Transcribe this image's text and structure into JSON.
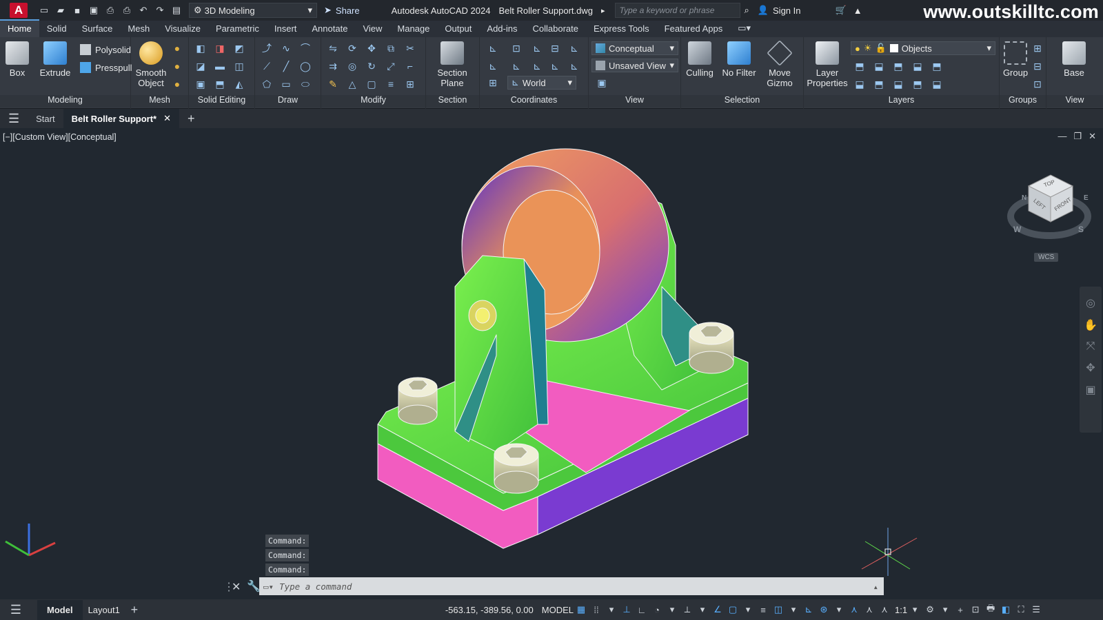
{
  "titlebar": {
    "logo": "A",
    "workspace": "3D Modeling",
    "share": "Share",
    "app_title": "Autodesk AutoCAD 2024",
    "file_name": "Belt Roller Support.dwg",
    "search_placeholder": "Type a keyword or phrase",
    "sign_in": "Sign In",
    "watermark": "www.outskilltc.com"
  },
  "ribbon_tabs": [
    "Home",
    "Solid",
    "Surface",
    "Mesh",
    "Visualize",
    "Parametric",
    "Insert",
    "Annotate",
    "View",
    "Manage",
    "Output",
    "Add-ins",
    "Collaborate",
    "Express Tools",
    "Featured Apps"
  ],
  "active_tab": "Home",
  "ribbon": {
    "modeling": {
      "label": "Modeling",
      "box": "Box",
      "extrude": "Extrude",
      "polysolid": "Polysolid",
      "presspull": "Presspull"
    },
    "mesh": {
      "label": "Mesh",
      "smooth1": "Smooth",
      "smooth2": "Object"
    },
    "solid_editing": {
      "label": "Solid Editing"
    },
    "draw": {
      "label": "Draw"
    },
    "modify": {
      "label": "Modify"
    },
    "section": {
      "label": "Section",
      "plane1": "Section",
      "plane2": "Plane"
    },
    "coordinates": {
      "label": "Coordinates",
      "ucs": "World"
    },
    "view": {
      "label": "View",
      "visual_style": "Conceptual",
      "saved_view": "Unsaved View"
    },
    "selection": {
      "label": "Selection",
      "culling": "Culling",
      "no_filter": "No Filter",
      "move1": "Move",
      "move2": "Gizmo"
    },
    "layers": {
      "label": "Layers",
      "props1": "Layer",
      "props2": "Properties",
      "current_layer": "Objects"
    },
    "groups": {
      "label": "Groups",
      "group": "Group"
    },
    "view2": {
      "label": "View",
      "base": "Base"
    }
  },
  "file_tabs": {
    "start": "Start",
    "active": "Belt Roller Support*"
  },
  "viewport": {
    "label": "[−][Custom View][Conceptual]",
    "viewcube": {
      "top": "TOP",
      "left": "LEFT",
      "front": "FRONT",
      "wcs": "WCS",
      "compass_w": "W",
      "compass_s": "S",
      "compass_n": "N",
      "compass_e": "E"
    }
  },
  "command_history": [
    "Command:",
    "Command:",
    "Command:"
  ],
  "command_placeholder": "Type a command",
  "statusbar": {
    "model_tab": "Model",
    "layout_tab": "Layout1",
    "coords": "-563.15, -389.56, 0.00",
    "space": "MODEL",
    "scale": "1:1"
  },
  "colors": {
    "accent": "#5aa0e0",
    "background": "#212830",
    "green": "#5ed84a",
    "magenta": "#f25cc0",
    "orange": "#e38a4e",
    "purple": "#7a3bd1"
  }
}
